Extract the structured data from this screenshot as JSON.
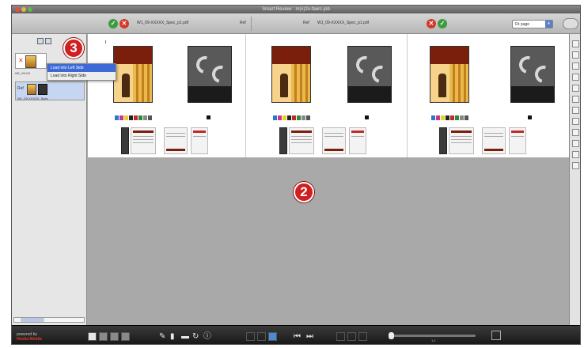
{
  "window": {
    "title": "Smart Review : m(x)2x-faerc.job"
  },
  "toolbar": {
    "left_file": "W1_09-XXXXX_Spec_p1.pdf",
    "left_mode": "Ref",
    "right_mode": "Ref",
    "right_file": "W1_09-XXXXX_Spec_p1.pdf",
    "approve_glyph": "✓",
    "reject_glyph": "✕",
    "zoom_value": "Fit page",
    "zoom_arrow": "▾"
  },
  "sidebar": {
    "item1_label": "W1_09-XX",
    "item2_label": "W1_09-XXXXX_Spec",
    "item2_mode": "Ref",
    "item1_mode": "✕"
  },
  "context_menu": {
    "items": [
      "Load into Left Side",
      "Load into Right Side"
    ]
  },
  "bottombar": {
    "logo_line1": "powered by",
    "logo_line2": "Hestia Mobile",
    "slider_label": "1:1"
  },
  "callouts": {
    "main": "2",
    "sidebar": "3"
  },
  "colors": {
    "callout": "#d11f1f",
    "approve": "#3c9b3c",
    "reject": "#d13a2a",
    "menu_highlight": "#3d6ad4"
  },
  "icons": {
    "toolbar": [
      "approve-icon",
      "reject-icon",
      "reject-icon",
      "approve-icon"
    ],
    "bottom": [
      "grid-view-icon",
      "list-view-icon",
      "film-view-icon",
      "page-view-icon",
      "measure-icon",
      "pin-icon",
      "note-icon",
      "rotate-icon",
      "info-icon",
      "single-page-icon",
      "double-page-icon",
      "spread-page-icon",
      "prev-icon",
      "next-icon",
      "fit-icon",
      "fullscreen-icon"
    ]
  }
}
